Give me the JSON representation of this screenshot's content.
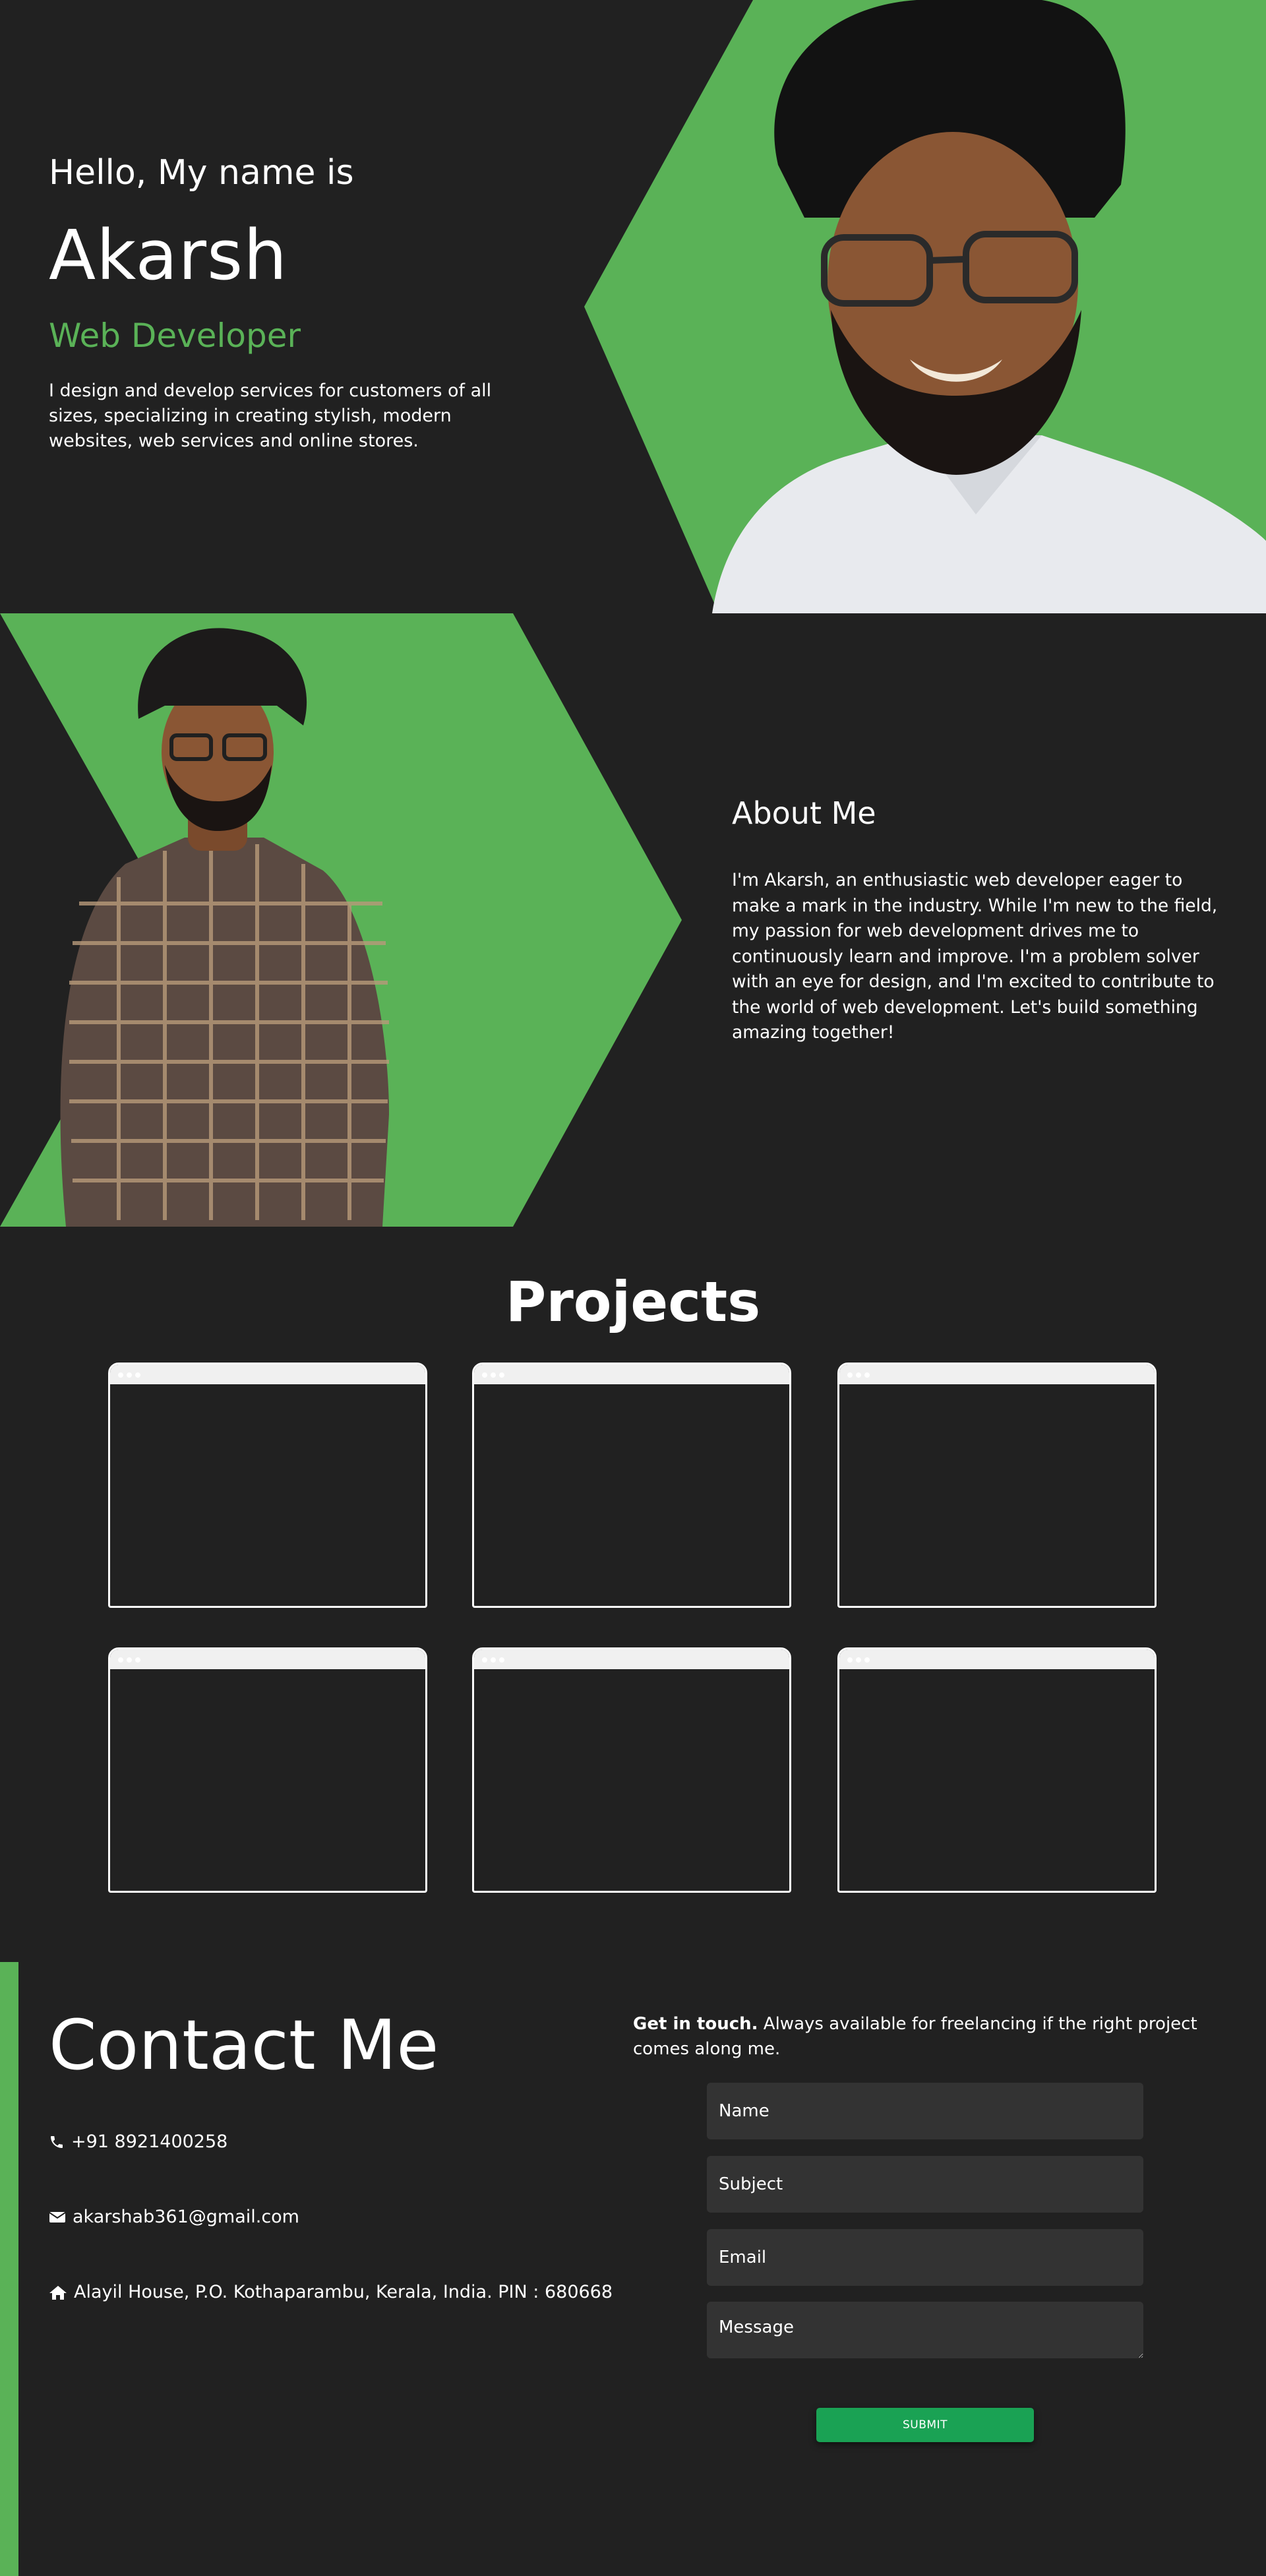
{
  "theme_toggle": {
    "icon": "moon-icon"
  },
  "hero": {
    "greeting": "Hello, My name is",
    "name": "Akarsh",
    "role": "Web Developer",
    "description": "I design and develop services for customers of all sizes, specializing in creating stylish, modern websites, web services and online stores."
  },
  "about": {
    "title": "About Me",
    "text": "I'm Akarsh, an enthusiastic web developer eager to make a mark in the industry. While I'm new to the field, my passion for web development drives me to continuously learn and improve. I'm a problem solver with an eye for design, and I'm excited to contribute to the world of web development. Let's build something amazing together!"
  },
  "projects": {
    "title": "Projects"
  },
  "contact": {
    "title": "Contact Me",
    "phone": "+91 8921400258",
    "email": "akarshab361@gmail.com",
    "address": "Alayil House, P.O. Kothaparambu, Kerala, India. PIN : 680668",
    "intro_bold": "Get in touch.",
    "intro_rest": " Always available for freelancing if the right project comes along me.",
    "form": {
      "name_placeholder": "Name",
      "subject_placeholder": "Subject",
      "email_placeholder": "Email",
      "message_placeholder": "Message",
      "submit_label": "SUBMIT"
    }
  },
  "colors": {
    "background": "#212121",
    "accent": "#5ab257",
    "submit": "#1aa254",
    "field": "#333333"
  }
}
